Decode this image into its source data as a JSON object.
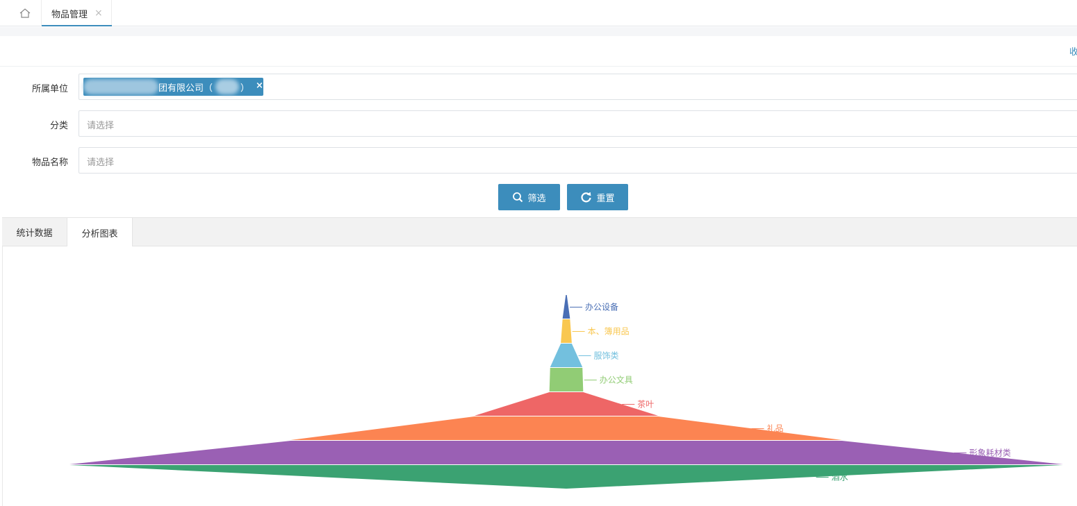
{
  "tabs": {
    "home_icon": "home-icon",
    "current": {
      "label": "物品管理",
      "close": "×"
    }
  },
  "toolbar": {
    "collapse_label": "收"
  },
  "form": {
    "unit": {
      "label": "所属单位",
      "chip_text": "团有限公司（",
      "chip_text_end": "）",
      "chip_close": "×"
    },
    "category": {
      "label": "分类",
      "placeholder": "请选择"
    },
    "item_name": {
      "label": "物品名称",
      "placeholder": "请选择"
    }
  },
  "buttons": {
    "filter": {
      "label": "筛选",
      "icon": "search-icon"
    },
    "reset": {
      "label": "重置",
      "icon": "refresh-icon"
    }
  },
  "result_tabs": [
    {
      "label": "统计数据",
      "active": false
    },
    {
      "label": "分析图表",
      "active": true
    }
  ],
  "chart_data": {
    "type": "funnel",
    "sort": "ascending",
    "categories": [
      "办公设备",
      "本、簿用品",
      "服饰类",
      "办公文具",
      "茶叶",
      "礼品",
      "形象耗材类",
      "酒水"
    ],
    "values": [
      0.2,
      1.5,
      2.2,
      6.5,
      6.8,
      37,
      111,
      200
    ],
    "colors": [
      "#4a6fb5",
      "#f9c750",
      "#73c0de",
      "#91cc75",
      "#ee6666",
      "#fc8452",
      "#9a60b4",
      "#3ba272"
    ]
  }
}
